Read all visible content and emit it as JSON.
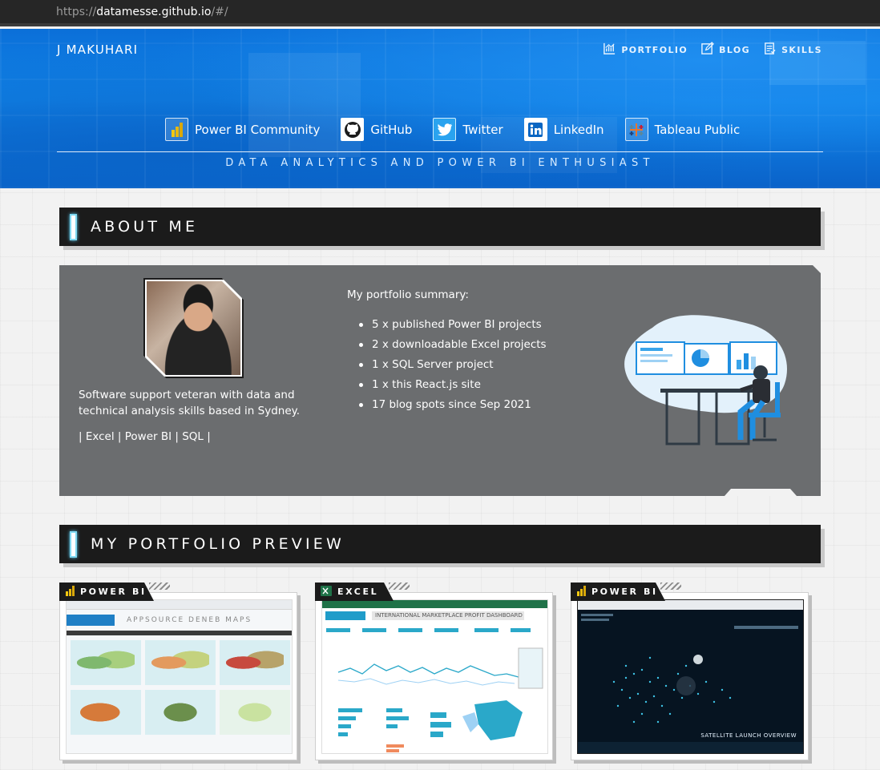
{
  "browser": {
    "url_prefix": "https://",
    "url_host": "datamesse.github.io",
    "url_path": "/#/"
  },
  "header": {
    "brand": "J MAKUHARI",
    "nav": [
      {
        "label": "PORTFOLIO",
        "icon": "chart-icon"
      },
      {
        "label": "BLOG",
        "icon": "edit-icon"
      },
      {
        "label": "SKILLS",
        "icon": "checklist-icon"
      }
    ],
    "social": [
      {
        "label": "Power BI Community",
        "icon": "powerbi-icon"
      },
      {
        "label": "GitHub",
        "icon": "github-icon"
      },
      {
        "label": "Twitter",
        "icon": "twitter-icon"
      },
      {
        "label": "LinkedIn",
        "icon": "linkedin-icon"
      },
      {
        "label": "Tableau Public",
        "icon": "tableau-icon"
      }
    ],
    "tagline": "DATA ANALYTICS AND POWER BI ENTHUSIAST"
  },
  "about": {
    "heading": "ABOUT ME",
    "bio": "Software support veteran with data and technical analysis skills based in Sydney.",
    "skills": "| Excel | Power BI | SQL |",
    "summary_heading": "My portfolio summary:",
    "summary_items": [
      "5 x published Power BI projects",
      "2 x downloadable Excel projects",
      "1 x SQL Server project",
      "1 x this React.js site",
      "17 blog spots since Sep 2021"
    ]
  },
  "portfolio": {
    "heading": "MY PORTFOLIO PREVIEW",
    "cards": [
      {
        "tag": "POWER BI",
        "icon": "powerbi-icon",
        "shot_title": "APPSOURCE DENEB MAPS"
      },
      {
        "tag": "EXCEL",
        "icon": "excel-icon",
        "shot_title": "INTERNATIONAL MARKETPLACE PROFIT DASHBOARD"
      },
      {
        "tag": "POWER BI",
        "icon": "powerbi-icon",
        "shot_title": "SATELLITE LAUNCH OVERVIEW"
      }
    ]
  },
  "colors": {
    "header_blue": "#0b6fd8",
    "panel_gray": "#6b6d6f",
    "section_dark": "#1b1b1b",
    "accent_cyan": "#7fd9f2"
  }
}
